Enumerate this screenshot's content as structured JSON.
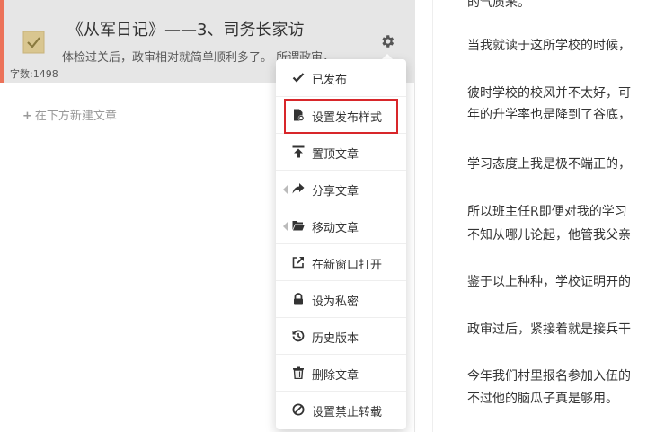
{
  "note": {
    "title": "《从军日记》——3、司务长家访",
    "abstract": "体检过关后，政审相对就简单顺利多了。 所谓政审，…",
    "word_count": "字数:1498"
  },
  "new_note_label": "在下方新建文章",
  "menu": {
    "items": [
      {
        "label": "已发布",
        "icon": "check-icon"
      },
      {
        "label": "设置发布样式",
        "icon": "file-gear-icon"
      },
      {
        "label": "置顶文章",
        "icon": "pin-top-icon"
      },
      {
        "label": "分享文章",
        "icon": "share-icon"
      },
      {
        "label": "移动文章",
        "icon": "folder-open-icon"
      },
      {
        "label": "在新窗口打开",
        "icon": "external-link-icon"
      },
      {
        "label": "设为私密",
        "icon": "lock-icon"
      },
      {
        "label": "历史版本",
        "icon": "history-icon"
      },
      {
        "label": "删除文章",
        "icon": "trash-icon"
      },
      {
        "label": "设置禁止转载",
        "icon": "ban-icon"
      }
    ]
  },
  "editor": {
    "lines": [
      "的气质来。",
      "当我就读于这所学校的时候，",
      "彼时学校的校风并不太好，可",
      "年的升学率也是降到了谷底，",
      "学习态度上我是极不端正的，",
      "所以班主任R即便对我的学习",
      "不知从哪儿论起，他管我父亲",
      "鉴于以上种种，学校证明开的",
      "政审过后，紧接着就是接兵干",
      "今年我们村里报名参加入伍的",
      "不过他的脑瓜子真是够用。"
    ]
  },
  "colors": {
    "accent": "#ec7259",
    "selected_bg": "#e6e6e6",
    "highlight": "#d8262a"
  }
}
